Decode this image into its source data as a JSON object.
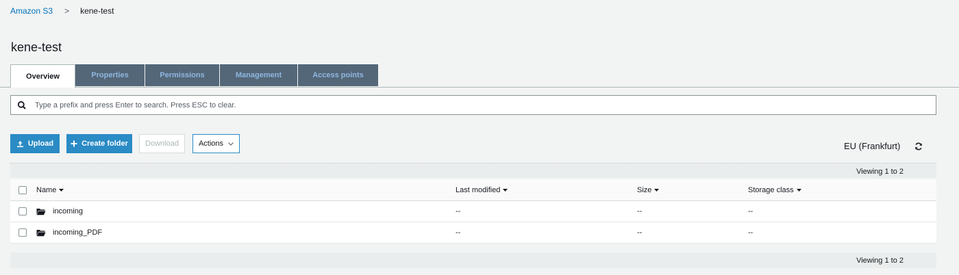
{
  "breadcrumb": {
    "root": "Amazon S3",
    "separator": ">",
    "current": "kene-test"
  },
  "page_title": "kene-test",
  "tabs": [
    {
      "label": "Overview",
      "active": true
    },
    {
      "label": "Properties",
      "active": false
    },
    {
      "label": "Permissions",
      "active": false
    },
    {
      "label": "Management",
      "active": false
    },
    {
      "label": "Access points",
      "active": false
    }
  ],
  "search": {
    "placeholder": "Type a prefix and press Enter to search. Press ESC to clear.",
    "value": "",
    "icon": "search-icon"
  },
  "toolbar": {
    "upload_label": "Upload",
    "create_folder_label": "Create folder",
    "download_label": "Download",
    "actions_label": "Actions",
    "region": "EU (Frankfurt)"
  },
  "viewing": "Viewing 1 to 2",
  "table": {
    "columns": [
      "Name",
      "Last modified",
      "Size",
      "Storage class"
    ],
    "rows": [
      {
        "name": "incoming",
        "last_modified": "--",
        "size": "--",
        "storage_class": "--",
        "icon": "folder-icon"
      },
      {
        "name": "incoming_PDF",
        "last_modified": "--",
        "size": "--",
        "storage_class": "--",
        "icon": "folder-icon"
      }
    ]
  },
  "colors": {
    "accent": "#2a8bc5",
    "link": "#0073bb",
    "tab_inactive_bg": "#546778",
    "tab_inactive_text": "#8fb7e0",
    "background": "#f2f3f3"
  }
}
